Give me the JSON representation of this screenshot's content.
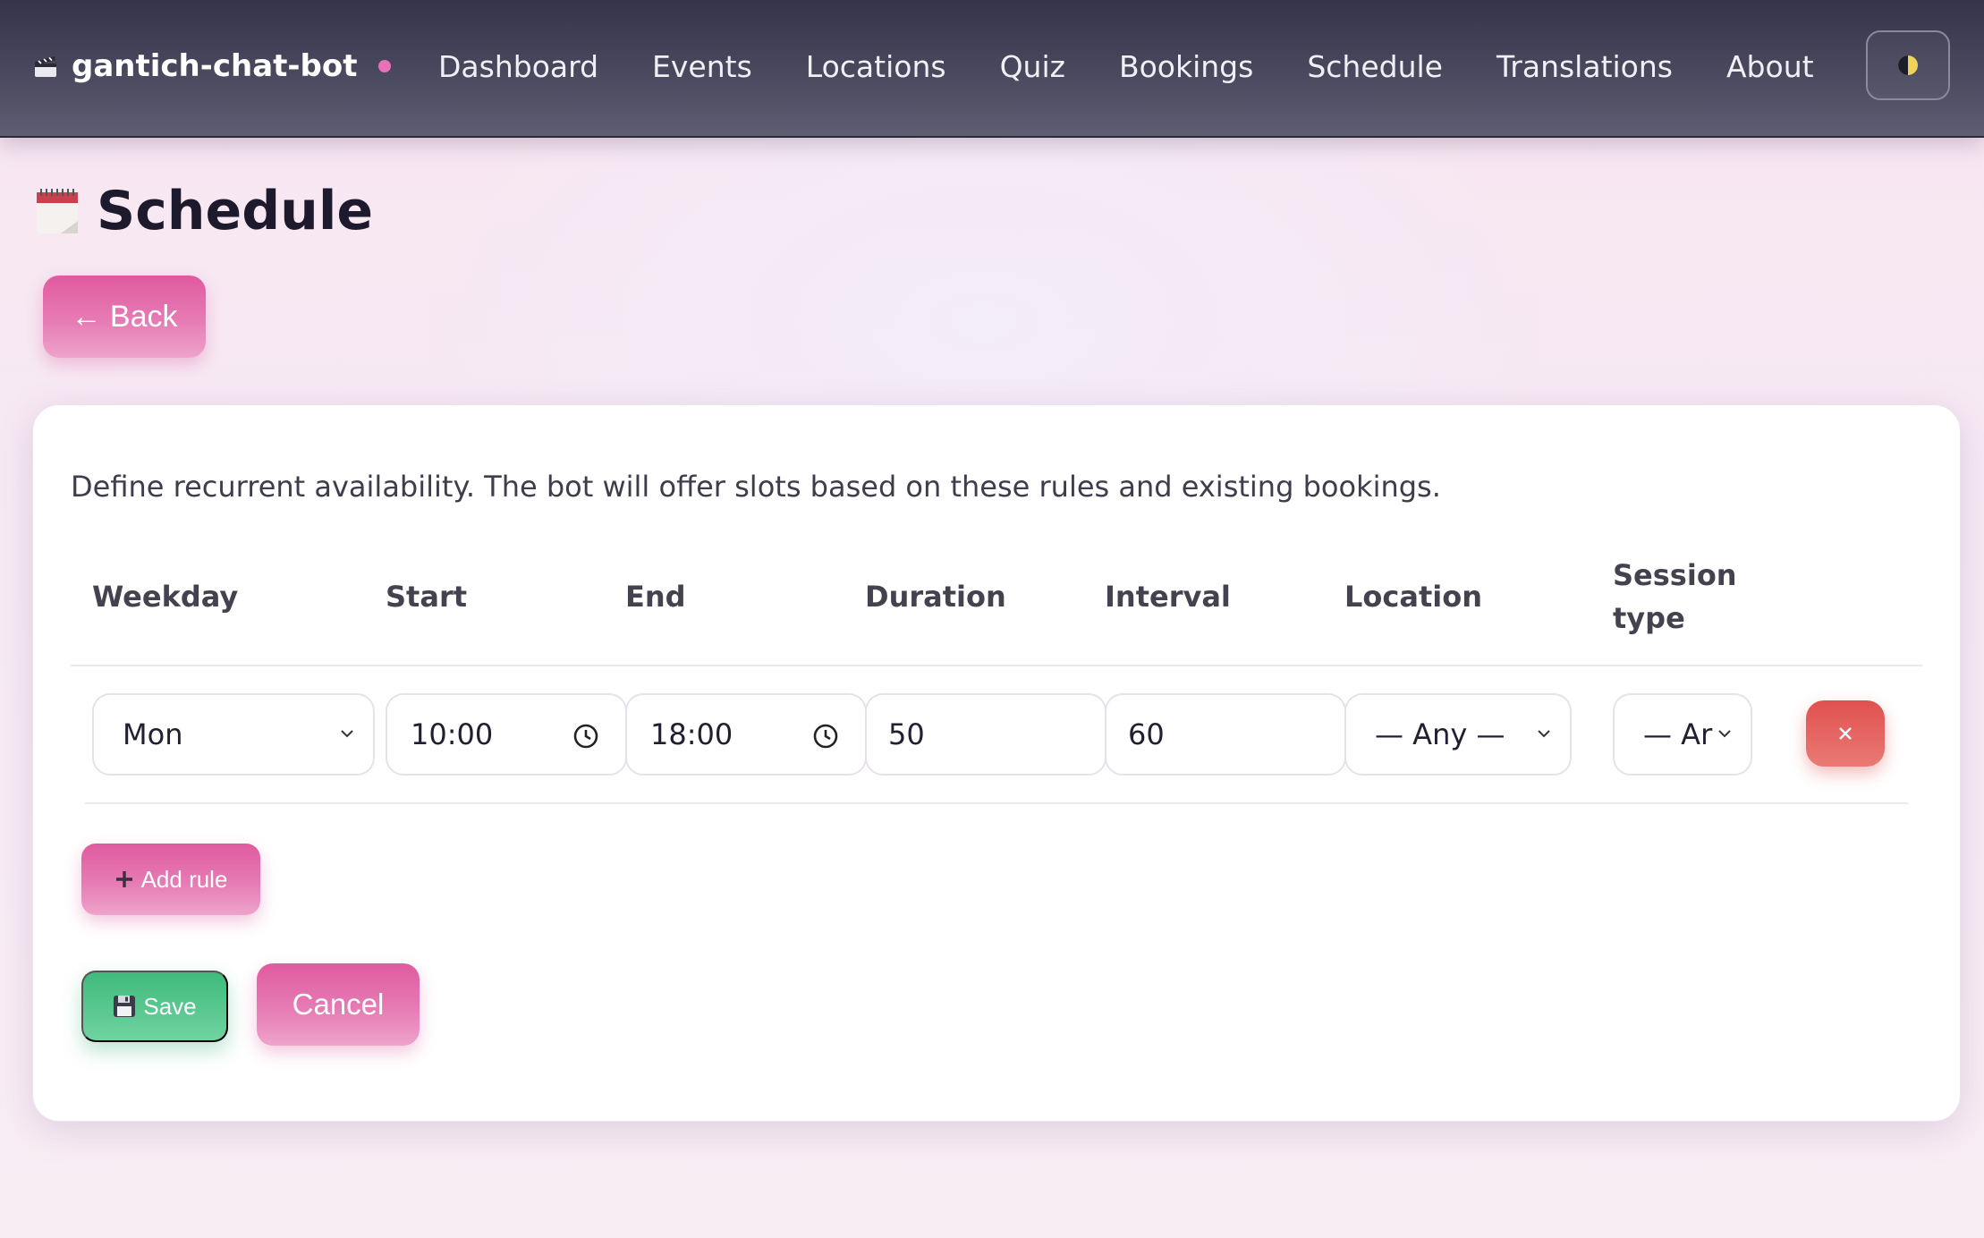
{
  "app": {
    "brand": "gantich-chat-bot",
    "brand_icon": "clapperboard-icon",
    "status_dot_color": "#e870b8"
  },
  "nav": {
    "items": [
      "Dashboard",
      "Events",
      "Locations",
      "Quiz",
      "Bookings",
      "Schedule",
      "Translations",
      "About"
    ],
    "theme_toggle_icon": "half-moon-icon"
  },
  "page": {
    "title": "Schedule",
    "title_icon": "calendar-icon",
    "back_label": "← Back"
  },
  "schedule": {
    "intro": "Define recurrent availability. The bot will offer slots based on these rules and existing bookings.",
    "columns": {
      "weekday": "Weekday",
      "start": "Start",
      "end": "End",
      "duration": "Duration",
      "interval": "Interval",
      "location": "Location",
      "session_type_1": "Session",
      "session_type_2": "type"
    },
    "rules": [
      {
        "weekday": "Mon",
        "start": "10:00",
        "end": "18:00",
        "duration": "50",
        "interval": "60",
        "location": "— Any —",
        "session_type": "— Ar"
      }
    ],
    "add_rule_label": "Add rule",
    "save_label": "Save",
    "cancel_label": "Cancel"
  },
  "colors": {
    "nav_bg": "#35344a",
    "accent_pink": "#e05aa0",
    "save_green": "#3fba7c",
    "delete_red": "#e05050"
  }
}
